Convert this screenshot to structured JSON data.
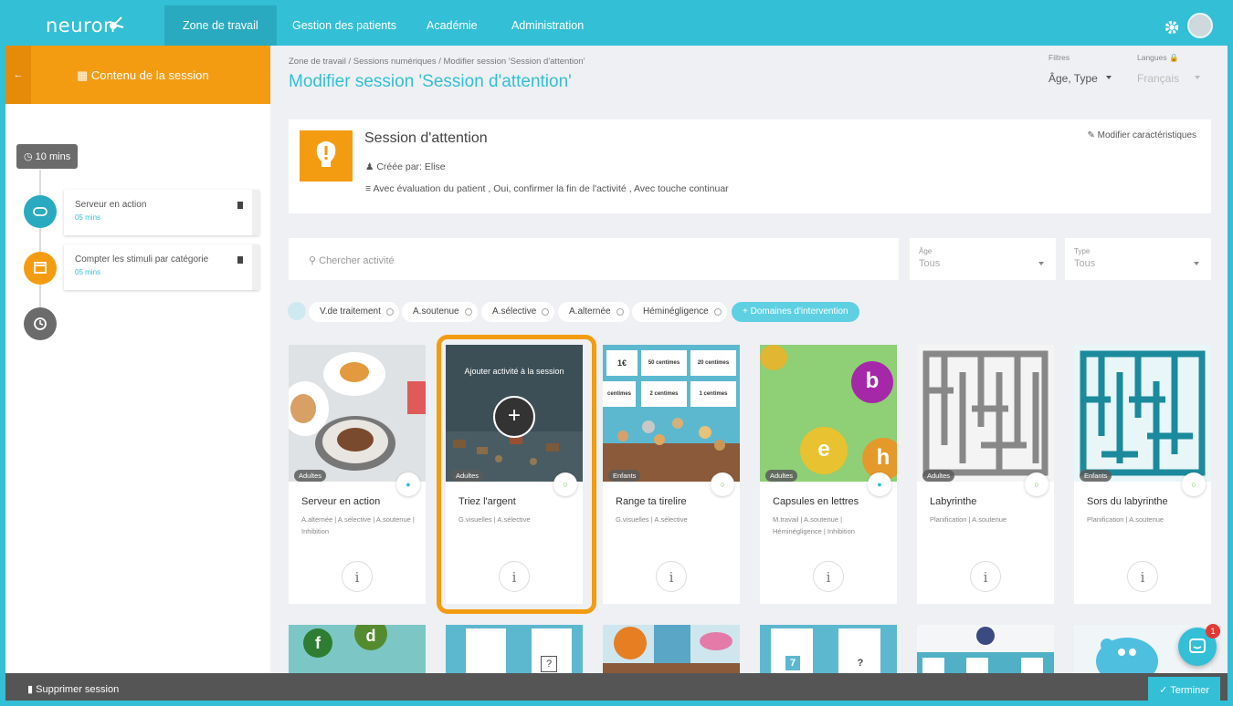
{
  "app": {
    "logo": "neuron"
  },
  "nav": {
    "items": [
      {
        "label": "Zone de travail"
      },
      {
        "label": "Gestion des patients"
      },
      {
        "label": "Académie"
      },
      {
        "label": "Administration"
      }
    ],
    "icons": [
      "gear-icon",
      "user-avatar-icon"
    ]
  },
  "sidebar": {
    "title": "Contenu de la session",
    "duration": "10 mins",
    "steps": [
      {
        "name": "Serveur en action",
        "time": "05 mins",
        "color": "#2aaac0",
        "icon": "gamepad-icon"
      },
      {
        "name": "Compter les stimuli par catégorie",
        "time": "05 mins",
        "color": "#f39c12",
        "icon": "window-icon"
      }
    ]
  },
  "header": {
    "breadcrumb": [
      "Zone de travail",
      "Sessions numériques",
      "Modifier session 'Session d'attention'"
    ],
    "title": "Modifier session 'Session d'attention'",
    "filters": {
      "label": "Filtres",
      "value": "Âge, Type"
    },
    "languages": {
      "label": "Langues",
      "value": "Français"
    }
  },
  "session": {
    "name": "Session d'attention",
    "creator": "Créée par: Elise",
    "options": "Avec évaluation du patient , Oui, confirmer la fin de l'activité , Avec touche continuar",
    "edit_label": "Modifier caractéristiques"
  },
  "search": {
    "placeholder": "Chercher activité",
    "age": {
      "label": "Âge",
      "value": "Tous"
    },
    "type": {
      "label": "Type",
      "value": "Tous"
    }
  },
  "domains": {
    "chips": [
      "V.de traitement",
      "A.soutenue",
      "A.sélective",
      "A.alternée",
      "Héminégligence"
    ],
    "add_label": "+ Domaines d'intervention"
  },
  "cards": [
    {
      "title": "Serveur en action",
      "badge": "Adultes",
      "tags": "A.alternée | A.sélective | A.soutenue | Inhibition"
    },
    {
      "title": "Triez l'argent",
      "badge": "Adultes",
      "tags": "G.visuelles | A.sélective",
      "hover_label": "Ajouter activité à la session"
    },
    {
      "title": "Range ta tirelire",
      "badge": "Enfants",
      "tags": "G.visuelles | A.sélective"
    },
    {
      "title": "Capsules en lettres",
      "badge": "Adultes",
      "tags": "M.travail | A.soutenue | Héminégligence | Inhibition"
    },
    {
      "title": "Labyrinthe",
      "badge": "Adultes",
      "tags": "Planification | A.soutenue"
    },
    {
      "title": "Sors du labyrinthe",
      "badge": "Enfants",
      "tags": "Planification | A.soutenue"
    }
  ],
  "coins": {
    "c1": "1€",
    "c2": "50 centimes",
    "c3": "20 centimes",
    "c4": "centimes",
    "c5": "2 centimes",
    "c6": "1 centimes"
  },
  "letters": {
    "l1": "b",
    "l2": "e",
    "l3": "h",
    "l4": "f",
    "l5": "d"
  },
  "row2": {
    "q1": "?",
    "q2": "7",
    "q3": "?"
  },
  "footer": {
    "delete_label": "Supprimer session",
    "finish_label": "Terminer",
    "chat_badge": "1"
  },
  "colors": {
    "brand": "#33bfd6",
    "accent": "#f39c12",
    "dark": "#555555"
  }
}
